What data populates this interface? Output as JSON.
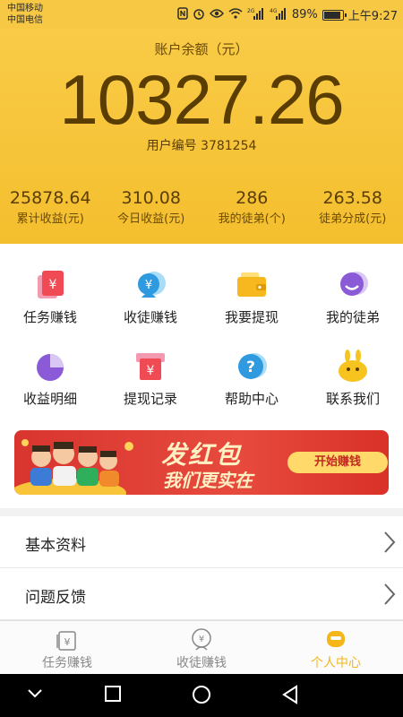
{
  "status_bar": {
    "carrier1": "中国移动",
    "carrier2": "中国电信",
    "signal1_tag": "2G",
    "signal2_tag": "4G",
    "battery": "89%",
    "battery_level": 0.89,
    "time": "上午9:27"
  },
  "account": {
    "balance_label": "账户余额（元）",
    "balance": "10327.26",
    "user_id": "用户编号 3781254",
    "stats": [
      {
        "value": "25878.64",
        "label": "累计收益(元)"
      },
      {
        "value": "310.08",
        "label": "今日收益(元)"
      },
      {
        "value": "286",
        "label": "我的徒弟(个)"
      },
      {
        "value": "263.58",
        "label": "徒弟分成(元)"
      }
    ]
  },
  "grid": {
    "items": [
      {
        "label": "任务赚钱",
        "icon": "task-money-icon"
      },
      {
        "label": "收徒赚钱",
        "icon": "recruit-money-icon"
      },
      {
        "label": "我要提现",
        "icon": "wallet-icon"
      },
      {
        "label": "我的徒弟",
        "icon": "apprentice-icon"
      },
      {
        "label": "收益明细",
        "icon": "pie-chart-icon"
      },
      {
        "label": "提现记录",
        "icon": "withdraw-record-icon"
      },
      {
        "label": "帮助中心",
        "icon": "help-icon"
      },
      {
        "label": "联系我们",
        "icon": "contact-icon"
      }
    ]
  },
  "banner": {
    "title": "发红包",
    "subtitle": "我们更实在",
    "button": "开始赚钱"
  },
  "menu": [
    {
      "label": "基本资料"
    },
    {
      "label": "问题反馈"
    }
  ],
  "tabs": [
    {
      "label": "任务赚钱",
      "active": false
    },
    {
      "label": "收徒赚钱",
      "active": false
    },
    {
      "label": "个人中心",
      "active": true
    }
  ],
  "colors": {
    "header": "#f7c843",
    "accent": "#f4b618",
    "text_brown": "#5a3d03",
    "banner_red": "#e1392f"
  }
}
